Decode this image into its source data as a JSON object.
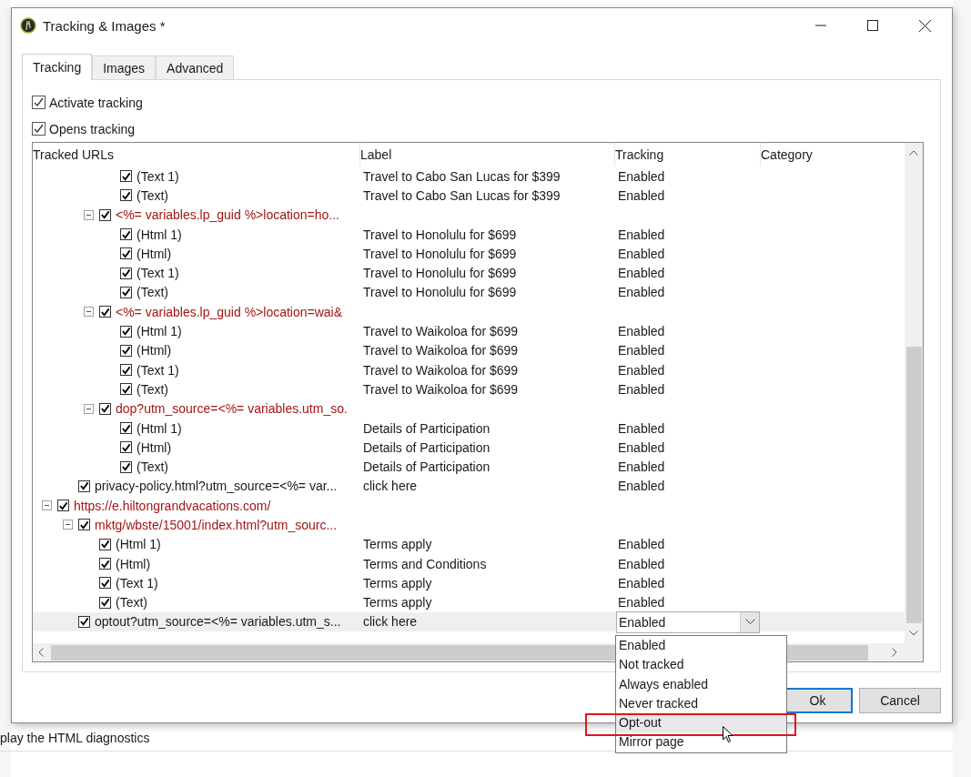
{
  "background": {
    "status_text": "play the HTML diagnostics"
  },
  "window": {
    "title": "Tracking & Images *"
  },
  "tabs": [
    {
      "label": "Tracking",
      "selected": true
    },
    {
      "label": "Images",
      "selected": false
    },
    {
      "label": "Advanced",
      "selected": false
    }
  ],
  "options": [
    {
      "label": "Activate tracking",
      "checked": true
    },
    {
      "label": "Opens tracking",
      "checked": true
    }
  ],
  "table": {
    "columns": [
      "Tracked URLs",
      "Label",
      "Tracking",
      "Category"
    ],
    "tree": [
      {
        "children": [
          {
            "children": [
              {
                "children": [
                  {
                    "kind": "content",
                    "name": "(Text 1)",
                    "checked": true,
                    "label": "Travel to Cabo San Lucas for $399",
                    "tracking": "Enabled"
                  },
                  {
                    "kind": "content",
                    "name": "(Text)",
                    "checked": true,
                    "label": "Travel to Cabo San Lucas for $399",
                    "tracking": "Enabled"
                  }
                ]
              },
              {
                "kind": "group",
                "name": "<%= variables.lp_guid %>location=ho...",
                "checked": true,
                "expanded": true,
                "children": [
                  {
                    "kind": "content",
                    "name": "(Html 1)",
                    "checked": true,
                    "label": "Travel to Honolulu for $699",
                    "tracking": "Enabled"
                  },
                  {
                    "kind": "content",
                    "name": "(Html)",
                    "checked": true,
                    "label": "Travel to Honolulu for $699",
                    "tracking": "Enabled"
                  },
                  {
                    "kind": "content",
                    "name": "(Text 1)",
                    "checked": true,
                    "label": "Travel to Honolulu for $699",
                    "tracking": "Enabled"
                  },
                  {
                    "kind": "content",
                    "name": "(Text)",
                    "checked": true,
                    "label": "Travel to Honolulu for $699",
                    "tracking": "Enabled"
                  }
                ]
              },
              {
                "kind": "group",
                "name": "<%= variables.lp_guid %>location=wai&",
                "checked": true,
                "expanded": true,
                "children": [
                  {
                    "kind": "content",
                    "name": "(Html 1)",
                    "checked": true,
                    "label": "Travel to Waikoloa for $699",
                    "tracking": "Enabled"
                  },
                  {
                    "kind": "content",
                    "name": "(Html)",
                    "checked": true,
                    "label": "Travel to Waikoloa for $699",
                    "tracking": "Enabled"
                  },
                  {
                    "kind": "content",
                    "name": "(Text 1)",
                    "checked": true,
                    "label": "Travel to Waikoloa for $699",
                    "tracking": "Enabled"
                  },
                  {
                    "kind": "content",
                    "name": "(Text)",
                    "checked": true,
                    "label": "Travel to Waikoloa for $699",
                    "tracking": "Enabled"
                  }
                ]
              },
              {
                "kind": "group",
                "name": "dop?utm_source=<%= variables.utm_so.",
                "checked": true,
                "expanded": true,
                "children": [
                  {
                    "kind": "content",
                    "name": "(Html 1)",
                    "checked": true,
                    "label": "Details of Participation",
                    "tracking": "Enabled"
                  },
                  {
                    "kind": "content",
                    "name": "(Html)",
                    "checked": true,
                    "label": "Details of Participation",
                    "tracking": "Enabled"
                  },
                  {
                    "kind": "content",
                    "name": "(Text)",
                    "checked": true,
                    "label": "Details of Participation",
                    "tracking": "Enabled"
                  }
                ]
              }
            ]
          },
          {
            "kind": "content",
            "name": "privacy-policy.html?utm_source=<%= var...",
            "checked": true,
            "label": "click here",
            "tracking": "Enabled"
          }
        ]
      },
      {
        "kind": "group",
        "name": "https://e.hiltongrandvacations.com/",
        "checked": true,
        "expanded": true,
        "children": [
          {
            "kind": "group",
            "name": "mktg/wbste/15001/index.html?utm_sourc...",
            "checked": true,
            "expanded": true,
            "children": [
              {
                "kind": "content",
                "name": "(Html 1)",
                "checked": true,
                "label": "Terms apply",
                "tracking": "Enabled"
              },
              {
                "kind": "content",
                "name": "(Html)",
                "checked": true,
                "label": "Terms and Conditions",
                "tracking": "Enabled"
              },
              {
                "kind": "content",
                "name": "(Text 1)",
                "checked": true,
                "label": "Terms apply",
                "tracking": "Enabled"
              },
              {
                "kind": "content",
                "name": "(Text)",
                "checked": true,
                "label": "Terms apply",
                "tracking": "Enabled"
              }
            ]
          },
          {
            "kind": "editing",
            "name": "optout?utm_source=<%= variables.utm_s...",
            "checked": true,
            "label": "click here",
            "tracking": "Enabled"
          }
        ]
      }
    ]
  },
  "dropdown": {
    "options": [
      {
        "label": "Enabled",
        "selected": false
      },
      {
        "label": "Not tracked",
        "selected": false
      },
      {
        "label": "Always enabled",
        "selected": false
      },
      {
        "label": "Never tracked",
        "selected": false
      },
      {
        "label": "Opt-out",
        "selected": true
      },
      {
        "label": "Mirror page",
        "selected": false
      }
    ]
  },
  "buttons": [
    {
      "label": "Ok",
      "kind": "default"
    },
    {
      "label": "Cancel",
      "kind": "normal"
    }
  ]
}
